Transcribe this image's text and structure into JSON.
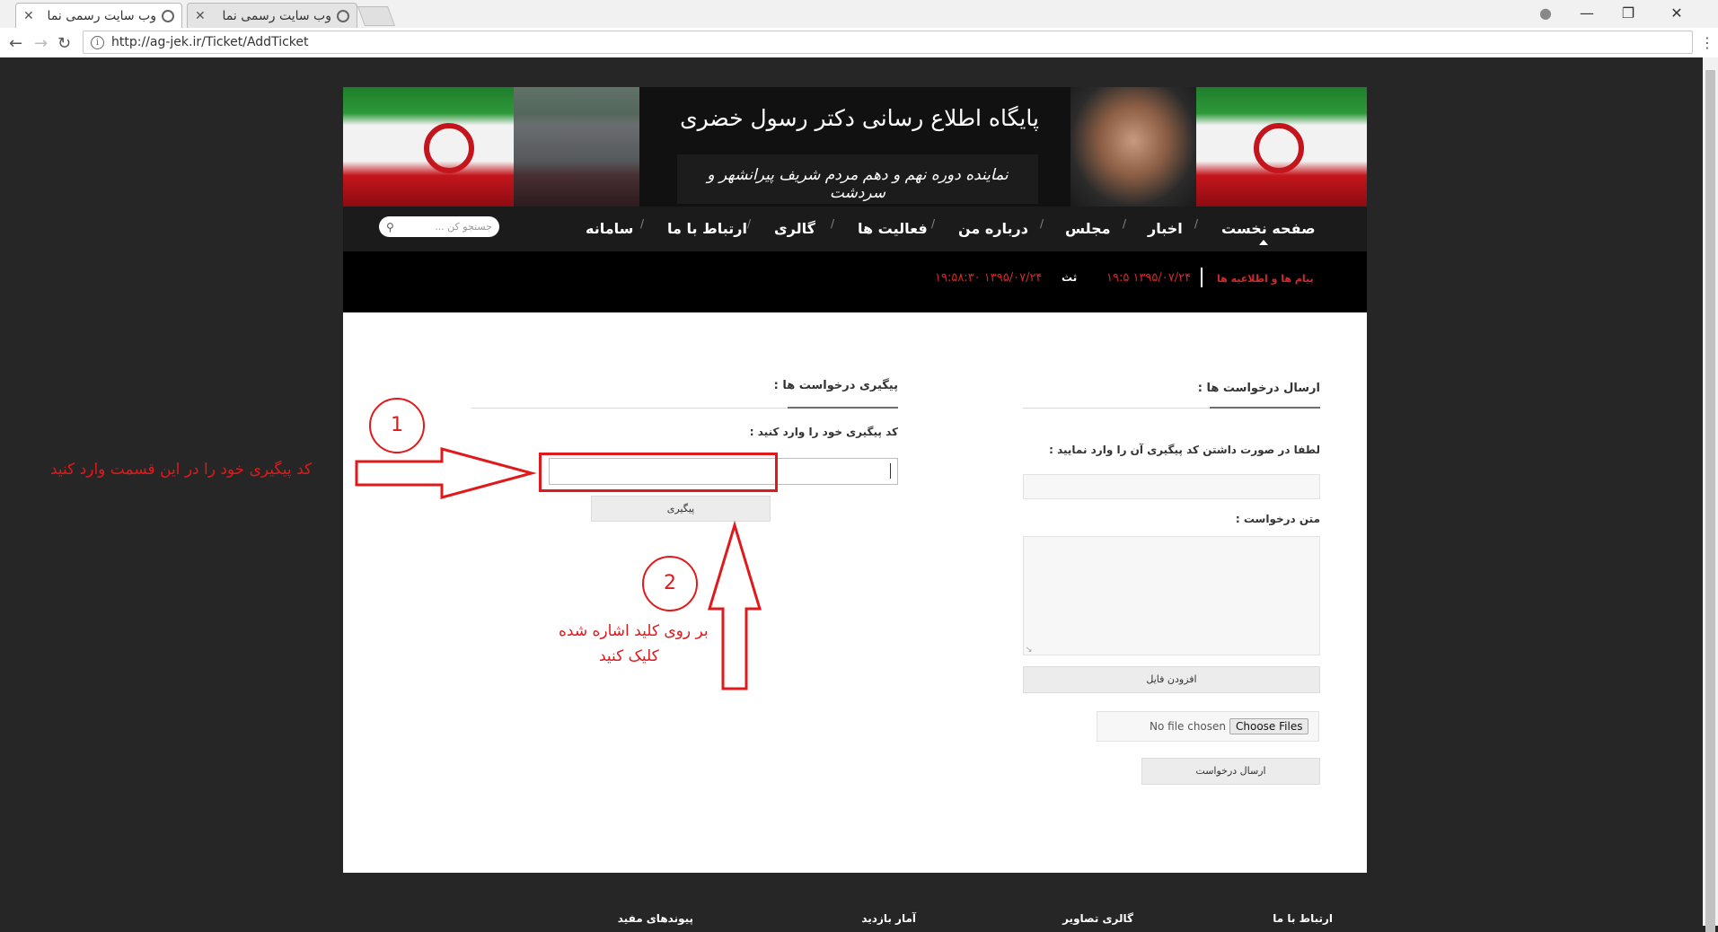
{
  "browser": {
    "tabs": [
      {
        "title": "وب سایت رسمی نما",
        "active": true
      },
      {
        "title": "وب سایت رسمی نما",
        "active": false
      }
    ],
    "url": "http://ag-jek.ir/Ticket/AddTicket"
  },
  "site": {
    "banner_title": "پایگاه اطلاع رسانی دکتر رسول خضری",
    "banner_subtitle": "نماینده دوره نهم و دهم مردم شریف پیرانشهر و سردشت",
    "nav": [
      "صفحه نخست",
      "اخبار",
      "مجلس",
      "درباره من",
      "فعالیت ها",
      "گالری",
      "ارتباط با ما",
      "سامانه"
    ],
    "search_placeholder": "جستجو کن ...",
    "ticker": {
      "label": "پیام ها و اطلاعیه ها",
      "item1": "۱۳۹۵/۰۷/۲۴ ۱۹:۵",
      "item2_prefix": "ثث",
      "item2": "۱۳۹۵/۰۷/۲۴ ۱۹:۵۸:۳۰"
    }
  },
  "send_panel": {
    "heading": "ارسال درخواست ها :",
    "code_label": "لطفا در صورت داشتن کد پیگیری آن را وارد نمایید :",
    "code_value": "",
    "text_label": "متن درخواست :",
    "text_value": "",
    "add_file_button": "افزودن فایل",
    "file_status": "No file chosen",
    "choose_files_button": "Choose Files",
    "submit_button": "ارسال درخواست"
  },
  "track_panel": {
    "heading": "پیگیری درخواست ها :",
    "code_label": "کد پیگیری خود را وارد کنید :",
    "code_value": "",
    "track_button": "پیگیری"
  },
  "annotations": {
    "step1_number": "1",
    "step1_text": "کد پیگیری خود را در این قسمت وارد کنید",
    "step2_number": "2",
    "step2_line1": "بر روی کلید اشاره شده",
    "step2_line2": "کلیک کنید",
    "color": "#e0191b"
  },
  "footer": [
    "ارتباط با ما",
    "گالری تصاویر",
    "آمار بازدید",
    "پیوندهای مفید"
  ]
}
